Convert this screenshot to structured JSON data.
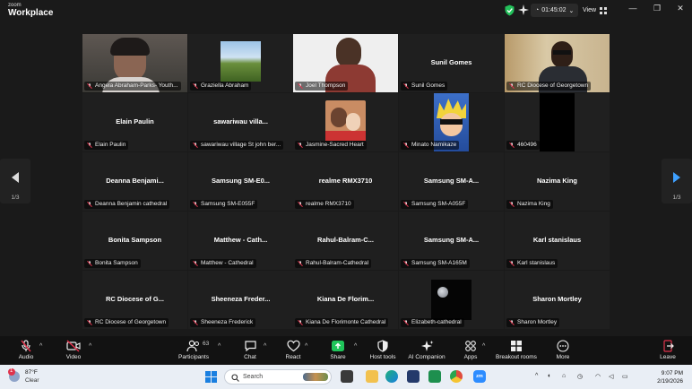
{
  "app": {
    "brand_small": "zoom",
    "brand_big": "Workplace"
  },
  "titlebar": {
    "timer": "01:45:02",
    "view_label": "View"
  },
  "tiles": [
    {
      "name": "",
      "label": "Angela Abraham-Parks- Youth...",
      "video": "angela",
      "active": true
    },
    {
      "name": "",
      "label": "Graziella Abraham",
      "video": "field"
    },
    {
      "name": "",
      "label": "Joel Thompson",
      "video": "joel"
    },
    {
      "name": "Sunil Gomes",
      "label": "Sunil Gomes"
    },
    {
      "name": "",
      "label": "RC Diocese of Georgetown",
      "video": "rcvideo"
    },
    {
      "name": "Elain Paulin",
      "label": "Elain Paulin"
    },
    {
      "name": "sawariwau  villa...",
      "label": "sawariwau village St john ber..."
    },
    {
      "name": "",
      "label": "Jasmine-Sacred Heart",
      "video": "jasmine"
    },
    {
      "name": "",
      "label": "Minato Namikaze",
      "video": "minato"
    },
    {
      "name": "",
      "label": "460496",
      "video": "black"
    },
    {
      "name": "Deanna  Benjami...",
      "label": "Deanna Benjamin cathedral"
    },
    {
      "name": "Samsung  SM-E0...",
      "label": "Samsung SM-E055F"
    },
    {
      "name": "realme RMX3710",
      "label": "realme RMX3710"
    },
    {
      "name": "Samsung  SM-A...",
      "label": "Samsung SM-A055F"
    },
    {
      "name": "Nazima King",
      "label": "Nazima King"
    },
    {
      "name": "Bonita Sampson",
      "label": "Bonita Sampson"
    },
    {
      "name": "Matthew - Cath...",
      "label": "Matthew - Cathedral"
    },
    {
      "name": "Rahul-Balram-C...",
      "label": "Rahul-Balram-Cathedral"
    },
    {
      "name": "Samsung  SM-A...",
      "label": "Samsung SM-A165M"
    },
    {
      "name": "Karl stanislaus",
      "label": "Karl stanislaus"
    },
    {
      "name": "RC Diocese of G...",
      "label": "RC Diocese of Georgetown"
    },
    {
      "name": "Sheeneza  Freder...",
      "label": "Sheeneza Frederick"
    },
    {
      "name": "Kiana  De Florim...",
      "label": "Kiana De Florimonte Cathedral"
    },
    {
      "name": "",
      "label": "Elizabeth-cathedral",
      "video": "moon"
    },
    {
      "name": "Sharon Mortley",
      "label": "Sharon Mortley"
    }
  ],
  "pager": {
    "left": "1/3",
    "right": "1/3"
  },
  "toolbar": {
    "participants_count": "63",
    "items": [
      {
        "label": "Audio"
      },
      {
        "label": "Video"
      },
      {
        "label": "Participants"
      },
      {
        "label": "Chat"
      },
      {
        "label": "React"
      },
      {
        "label": "Share"
      },
      {
        "label": "Host tools"
      },
      {
        "label": "AI Companion"
      },
      {
        "label": "Apps"
      },
      {
        "label": "Breakout rooms"
      },
      {
        "label": "More"
      },
      {
        "label": "Leave"
      }
    ]
  },
  "taskbar": {
    "weather_badge": "1",
    "temp": "87°F",
    "condition": "Clear",
    "search_placeholder": "Search",
    "time": "9:07 PM",
    "date": "2/19/2026"
  },
  "colors": {
    "active_border": "#23d96b",
    "share_green": "#1fc55a",
    "muted_red": "#e0334c",
    "leave_red": "#e0334c"
  }
}
